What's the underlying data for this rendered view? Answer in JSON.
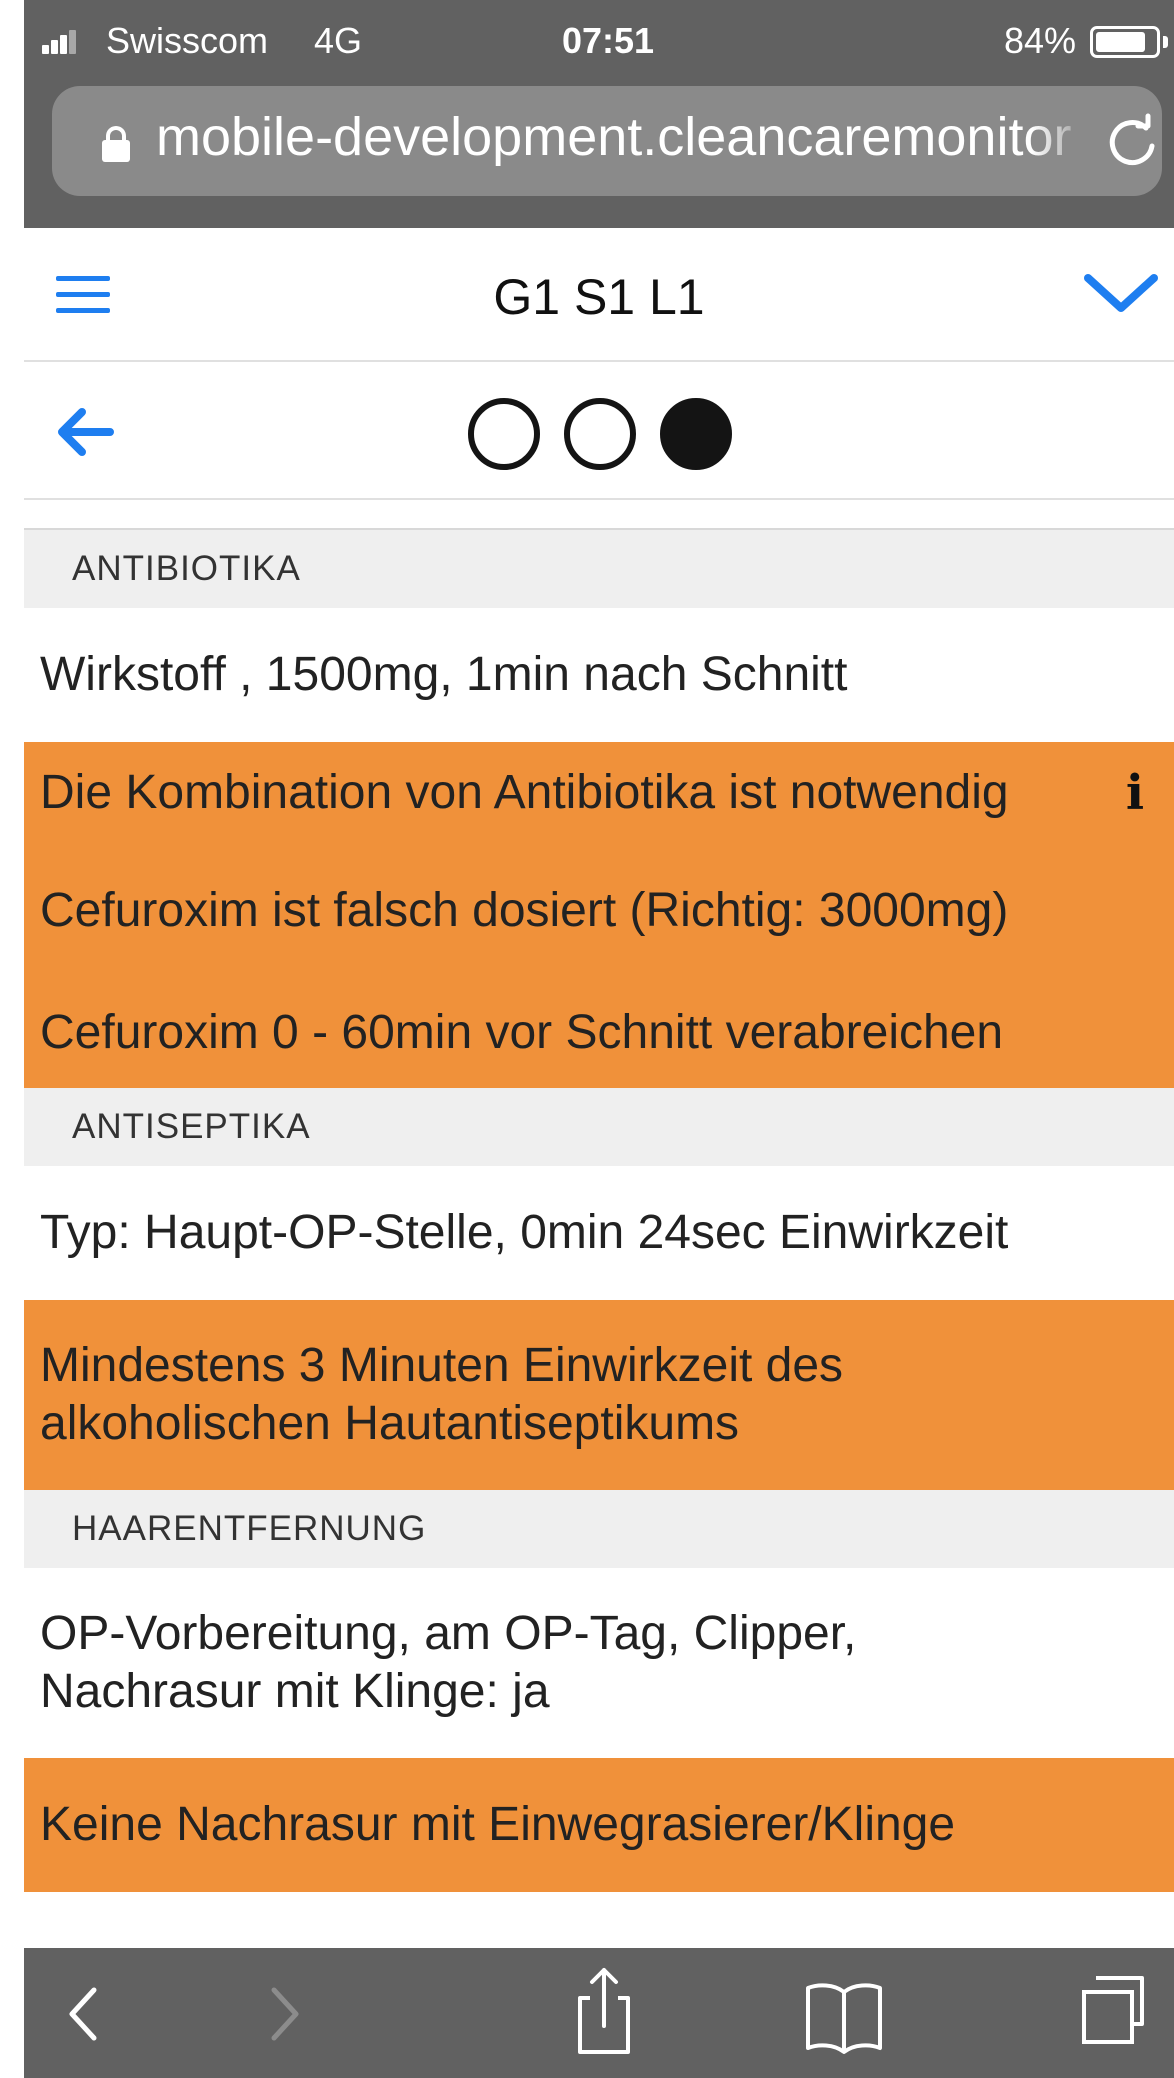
{
  "status_bar": {
    "carrier": "Swisscom",
    "network": "4G",
    "time": "07:51",
    "battery_percent": "84%",
    "battery_level": 0.84,
    "signal_icon": "signal-bars-icon"
  },
  "browser": {
    "url": "mobile-development.cleancaremonitor",
    "lock_icon": "lock-icon",
    "reload_icon": "reload-icon"
  },
  "header": {
    "title": "G1 S1 L1",
    "menu_icon": "hamburger-menu-icon",
    "dropdown_icon": "chevron-down-icon"
  },
  "stepper": {
    "back_icon": "back-arrow-icon",
    "total_steps": 3,
    "current_step": 3
  },
  "sections": [
    {
      "title": "ANTIBIOTIKA",
      "rows": [
        {
          "text": "Wirkstoff , 1500mg, 1min nach Schnitt",
          "type": "info"
        },
        {
          "text": "Die Kombination von Antibiotika ist notwendig",
          "type": "warning",
          "icon": "info-icon"
        },
        {
          "text": "Cefuroxim ist falsch dosiert (Richtig: 3000mg)",
          "type": "warning"
        },
        {
          "text": "Cefuroxim 0 - 60min vor Schnitt verabreichen",
          "type": "warning"
        }
      ]
    },
    {
      "title": "ANTISEPTIKA",
      "rows": [
        {
          "text": "Typ: Haupt-OP-Stelle, 0min 24sec Einwirkzeit",
          "type": "info"
        },
        {
          "text": "Mindestens 3 Minuten Einwirkzeit des alkoholischen Hautantiseptikums",
          "type": "warning"
        }
      ]
    },
    {
      "title": "HAARENTFERNUNG",
      "rows": [
        {
          "text": "OP-Vorbereitung,  am OP-Tag,  Clipper, Nachrasur mit Klinge: ja",
          "type": "info"
        },
        {
          "text": "Keine Nachrasur mit Einwegrasierer/Klinge",
          "type": "warning"
        }
      ]
    }
  ],
  "colors": {
    "warning": "#f0913a",
    "accent": "#1e7ef0",
    "chrome": "#616161",
    "section_header": "#efefef"
  },
  "toolbar": {
    "back_icon": "chevron-left-icon",
    "forward_icon": "chevron-right-icon",
    "share_icon": "share-icon",
    "bookmarks_icon": "book-icon",
    "tabs_icon": "tabs-icon"
  }
}
